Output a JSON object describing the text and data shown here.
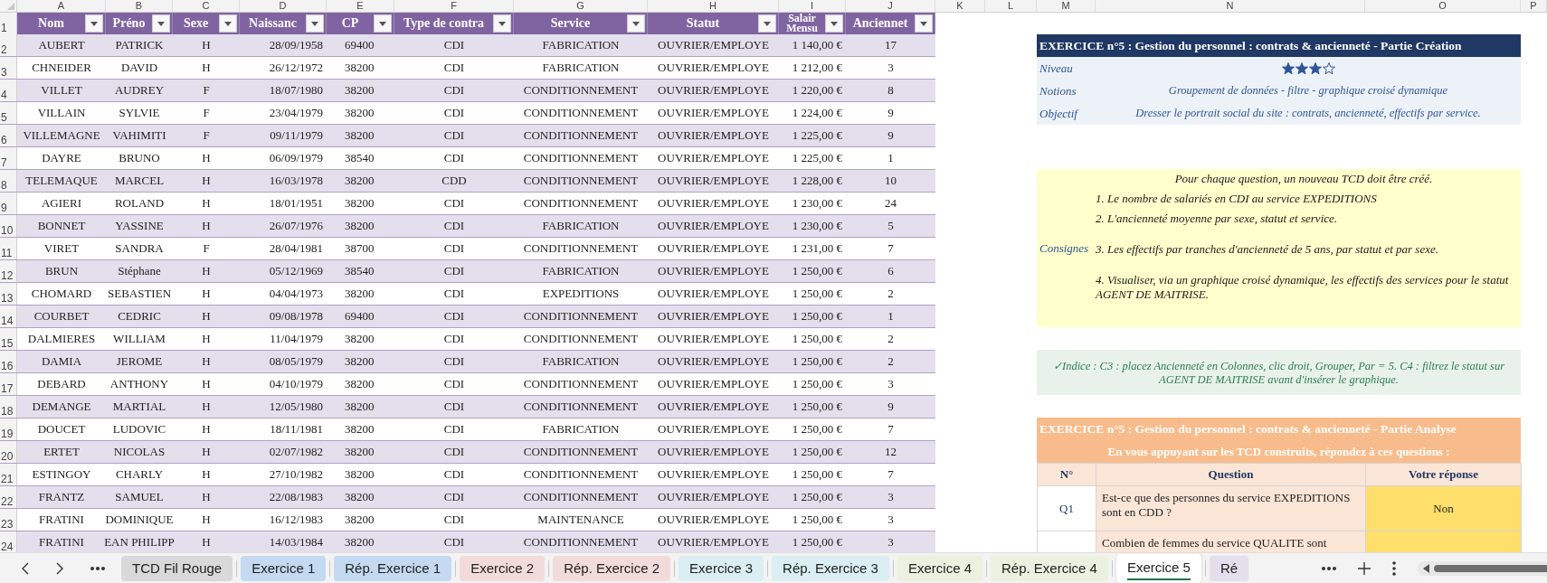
{
  "sheet": {
    "column_letters": [
      "A",
      "B",
      "C",
      "D",
      "E",
      "F",
      "G",
      "H",
      "I",
      "J",
      "K",
      "L",
      "M",
      "N",
      "O",
      "P"
    ],
    "header_row_number": "1",
    "columns": [
      {
        "label": "Nom"
      },
      {
        "label": "Préno"
      },
      {
        "label": "Sexe"
      },
      {
        "label": "Naissanc"
      },
      {
        "label": "CP"
      },
      {
        "label": "Type de contra"
      },
      {
        "label": "Service"
      },
      {
        "label": "Statut"
      },
      {
        "label": "Salair Mensu"
      },
      {
        "label": "Anciennet"
      }
    ],
    "rows": [
      {
        "num": "2",
        "cells": [
          "AUBERT",
          "PATRICK",
          "H",
          "28/09/1958",
          "69400",
          "CDI",
          "FABRICATION",
          "OUVRIER/EMPLOYE",
          "1 140,00 €",
          "17"
        ]
      },
      {
        "num": "3",
        "cells": [
          "CHNEIDER",
          "DAVID",
          "H",
          "26/12/1972",
          "38200",
          "CDI",
          "FABRICATION",
          "OUVRIER/EMPLOYE",
          "1 212,00 €",
          "3"
        ]
      },
      {
        "num": "4",
        "cells": [
          "VILLET",
          "AUDREY",
          "F",
          "18/07/1980",
          "38200",
          "CDI",
          "CONDITIONNEMENT",
          "OUVRIER/EMPLOYE",
          "1 220,00 €",
          "8"
        ]
      },
      {
        "num": "5",
        "cells": [
          "VILLAIN",
          "SYLVIE",
          "F",
          "23/04/1979",
          "38200",
          "CDI",
          "CONDITIONNEMENT",
          "OUVRIER/EMPLOYE",
          "1 224,00 €",
          "9"
        ]
      },
      {
        "num": "6",
        "cells": [
          "VILLEMAGNE",
          "VAHIMITI",
          "F",
          "09/11/1979",
          "38200",
          "CDI",
          "CONDITIONNEMENT",
          "OUVRIER/EMPLOYE",
          "1 225,00 €",
          "9"
        ]
      },
      {
        "num": "7",
        "cells": [
          "DAYRE",
          "BRUNO",
          "H",
          "06/09/1979",
          "38540",
          "CDI",
          "CONDITIONNEMENT",
          "OUVRIER/EMPLOYE",
          "1 225,00 €",
          "1"
        ]
      },
      {
        "num": "8",
        "cells": [
          "TELEMAQUE",
          "MARCEL",
          "H",
          "16/03/1978",
          "38200",
          "CDD",
          "CONDITIONNEMENT",
          "OUVRIER/EMPLOYE",
          "1 228,00 €",
          "10"
        ]
      },
      {
        "num": "9",
        "cells": [
          "AGIERI",
          "ROLAND",
          "H",
          "18/01/1951",
          "38200",
          "CDI",
          "CONDITIONNEMENT",
          "OUVRIER/EMPLOYE",
          "1 230,00 €",
          "24"
        ]
      },
      {
        "num": "10",
        "cells": [
          "BONNET",
          "YASSINE",
          "H",
          "26/07/1976",
          "38200",
          "CDI",
          "FABRICATION",
          "OUVRIER/EMPLOYE",
          "1 230,00 €",
          "5"
        ]
      },
      {
        "num": "11",
        "cells": [
          "VIRET",
          "SANDRA",
          "F",
          "28/04/1981",
          "38700",
          "CDI",
          "CONDITIONNEMENT",
          "OUVRIER/EMPLOYE",
          "1 231,00 €",
          "7"
        ]
      },
      {
        "num": "12",
        "cells": [
          "BRUN",
          "Stéphane",
          "H",
          "05/12/1969",
          "38540",
          "CDI",
          "FABRICATION",
          "OUVRIER/EMPLOYE",
          "1 250,00 €",
          "6"
        ]
      },
      {
        "num": "13",
        "cells": [
          "CHOMARD",
          "SEBASTIEN",
          "H",
          "04/04/1973",
          "38200",
          "CDI",
          "EXPEDITIONS",
          "OUVRIER/EMPLOYE",
          "1 250,00 €",
          "2"
        ]
      },
      {
        "num": "14",
        "cells": [
          "COURBET",
          "CEDRIC",
          "H",
          "09/08/1978",
          "69400",
          "CDI",
          "CONDITIONNEMENT",
          "OUVRIER/EMPLOYE",
          "1 250,00 €",
          "1"
        ]
      },
      {
        "num": "15",
        "cells": [
          "DALMIERES",
          "WILLIAM",
          "H",
          "11/04/1979",
          "38200",
          "CDI",
          "CONDITIONNEMENT",
          "OUVRIER/EMPLOYE",
          "1 250,00 €",
          "2"
        ]
      },
      {
        "num": "16",
        "cells": [
          "DAMIA",
          "JEROME",
          "H",
          "08/05/1979",
          "38200",
          "CDI",
          "FABRICATION",
          "OUVRIER/EMPLOYE",
          "1 250,00 €",
          "2"
        ]
      },
      {
        "num": "17",
        "cells": [
          "DEBARD",
          "ANTHONY",
          "H",
          "04/10/1979",
          "38200",
          "CDI",
          "CONDITIONNEMENT",
          "OUVRIER/EMPLOYE",
          "1 250,00 €",
          "3"
        ]
      },
      {
        "num": "18",
        "cells": [
          "DEMANGE",
          "MARTIAL",
          "H",
          "12/05/1980",
          "38200",
          "CDI",
          "CONDITIONNEMENT",
          "OUVRIER/EMPLOYE",
          "1 250,00 €",
          "9"
        ]
      },
      {
        "num": "19",
        "cells": [
          "DOUCET",
          "LUDOVIC",
          "H",
          "18/11/1981",
          "38200",
          "CDI",
          "FABRICATION",
          "OUVRIER/EMPLOYE",
          "1 250,00 €",
          "7"
        ]
      },
      {
        "num": "20",
        "cells": [
          "ERTET",
          "NICOLAS",
          "H",
          "02/07/1982",
          "38200",
          "CDI",
          "CONDITIONNEMENT",
          "OUVRIER/EMPLOYE",
          "1 250,00 €",
          "12"
        ]
      },
      {
        "num": "21",
        "cells": [
          "ESTINGOY",
          "CHARLY",
          "H",
          "27/10/1982",
          "38200",
          "CDI",
          "CONDITIONNEMENT",
          "OUVRIER/EMPLOYE",
          "1 250,00 €",
          "7"
        ]
      },
      {
        "num": "22",
        "cells": [
          "FRANTZ",
          "SAMUEL",
          "H",
          "22/08/1983",
          "38200",
          "CDI",
          "CONDITIONNEMENT",
          "OUVRIER/EMPLOYE",
          "1 250,00 €",
          "3"
        ]
      },
      {
        "num": "23",
        "cells": [
          "FRATINI",
          "DOMINIQUE",
          "H",
          "16/12/1983",
          "38200",
          "CDI",
          "MAINTENANCE",
          "OUVRIER/EMPLOYE",
          "1 250,00 €",
          "3"
        ]
      },
      {
        "num": "24",
        "cells": [
          "FRATINI",
          "EAN PHILIPP",
          "H",
          "14/03/1984",
          "38200",
          "CDI",
          "CONDITIONNEMENT",
          "OUVRIER/EMPLOYE",
          "1 250,00 €",
          "3"
        ]
      }
    ]
  },
  "creation": {
    "title": "EXERCICE n°5 : Gestion du personnel : contrats & ancienneté - Partie Création",
    "level": {
      "label": "Niveau",
      "stars": 3
    },
    "info": [
      {
        "label": "Notions",
        "value": "Groupement de données - filtre - graphique croisé dynamique"
      },
      {
        "label": "Objectif",
        "value": "Dresser le portrait social du site : contrats, ancienneté, effectifs par service."
      }
    ]
  },
  "instructions": {
    "label": "Consignes",
    "intro": "Pour chaque question, un nouveau TCD doit être créé.",
    "items": [
      "1. Le nombre de salariés en CDI au service EXPEDITIONS",
      "2. L'ancienneté moyenne par sexe, statut et service.",
      "3. Les effectifs par tranches d'ancienneté de 5 ans, par statut et par sexe.",
      "4. Visualiser, via un graphique croisé dynamique, les effectifs des services pour le statut AGENT DE MAITRISE."
    ]
  },
  "hint": "✓Indice : C3 : placez Ancienneté en Colonnes, clic droit, Grouper, Par = 5. C4 : filtrez le statut sur AGENT DE MAITRISE avant d'insérer le graphique.",
  "analysis": {
    "title": "EXERCICE n°5 : Gestion du personnel : contrats & ancienneté - Partie Analyse",
    "subtitle": "En vous appuyant sur les TCD construits, répondez à ces questions :",
    "columns": [
      "N°",
      "Question",
      "Votre réponse"
    ],
    "rows": [
      {
        "num": "Q1",
        "question": "Est-ce que des personnes du service EXPEDITIONS sont en CDD ?",
        "answer": "Non"
      },
      {
        "question": "Combien de femmes du service QUALITE sont"
      }
    ]
  },
  "tabs": [
    {
      "label": "TCD Fil Rouge",
      "color": "#d9d9d9",
      "selected": false
    },
    {
      "label": "Exercice 1",
      "color": "#c5d9f1",
      "selected": false
    },
    {
      "label": "Rép. Exercice 1",
      "color": "#c5d9f1",
      "selected": false
    },
    {
      "label": "Exercice 2",
      "color": "#f2dcdb",
      "selected": false
    },
    {
      "label": "Rép. Exercice 2",
      "color": "#f2dcdb",
      "selected": false
    },
    {
      "label": "Exercice 3",
      "color": "#daeef3",
      "selected": false
    },
    {
      "label": "Rép. Exercice 3",
      "color": "#daeef3",
      "selected": false
    },
    {
      "label": "Exercice 4",
      "color": "#ebf1de",
      "selected": false
    },
    {
      "label": "Rép. Exercice 4",
      "color": "#ebf1de",
      "selected": false
    },
    {
      "label": "Exercice 5",
      "color": "#217346",
      "selected": true
    },
    {
      "label": "Ré",
      "color": "#e4dfec",
      "selected": false
    }
  ]
}
